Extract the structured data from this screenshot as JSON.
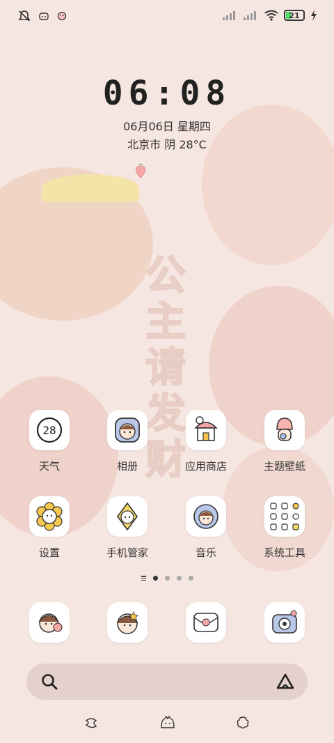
{
  "status_bar": {
    "battery_level": "21",
    "icons": [
      "bell-muted-icon",
      "notification-app-icon",
      "notification-app-icon-2",
      "signal-icon",
      "signal-icon-2",
      "wifi-icon",
      "battery-icon",
      "charging-icon"
    ]
  },
  "lockscreen": {
    "time": "06:08",
    "date": "06月06日 星期四",
    "weather": "北京市 阴 28°C"
  },
  "wallpaper": {
    "text_chars": [
      "公",
      "主",
      "请",
      "发",
      "财"
    ]
  },
  "apps": [
    {
      "label": "天气",
      "icon": "weather-icon",
      "badge": "28"
    },
    {
      "label": "相册",
      "icon": "gallery-icon"
    },
    {
      "label": "应用商店",
      "icon": "app-store-icon"
    },
    {
      "label": "主题壁纸",
      "icon": "themes-icon"
    },
    {
      "label": "设置",
      "icon": "settings-icon"
    },
    {
      "label": "手机管家",
      "icon": "security-icon"
    },
    {
      "label": "音乐",
      "icon": "music-icon"
    },
    {
      "label": "系统工具",
      "icon": "system-tools-folder-icon"
    }
  ],
  "dock": [
    {
      "icon": "phone-icon"
    },
    {
      "icon": "contacts-icon"
    },
    {
      "icon": "messages-icon"
    },
    {
      "icon": "camera-icon"
    }
  ],
  "pager": {
    "pages": 4,
    "active": 1
  },
  "search": {
    "placeholder": ""
  },
  "nav": {
    "buttons": [
      "nav-menu-icon",
      "nav-home-icon",
      "nav-back-icon"
    ]
  },
  "colors": {
    "background": "#f6e6e1",
    "accent_pink": "#f4a7a7",
    "battery_green": "#4cd964"
  }
}
